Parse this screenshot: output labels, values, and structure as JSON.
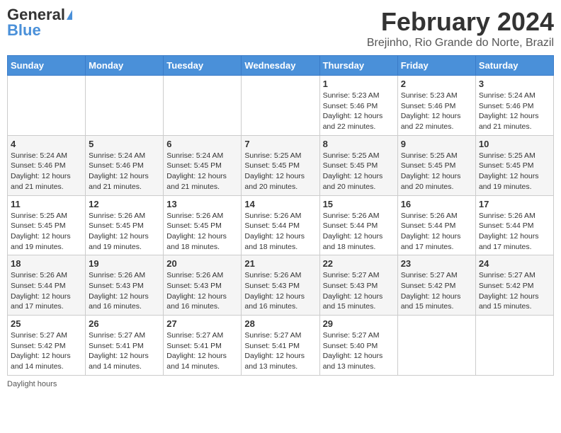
{
  "logo": {
    "general": "General",
    "blue": "Blue"
  },
  "title": "February 2024",
  "subtitle": "Brejinho, Rio Grande do Norte, Brazil",
  "days_of_week": [
    "Sunday",
    "Monday",
    "Tuesday",
    "Wednesday",
    "Thursday",
    "Friday",
    "Saturday"
  ],
  "weeks": [
    [
      {
        "day": "",
        "info": ""
      },
      {
        "day": "",
        "info": ""
      },
      {
        "day": "",
        "info": ""
      },
      {
        "day": "",
        "info": ""
      },
      {
        "day": "1",
        "info": "Sunrise: 5:23 AM\nSunset: 5:46 PM\nDaylight: 12 hours and 22 minutes."
      },
      {
        "day": "2",
        "info": "Sunrise: 5:23 AM\nSunset: 5:46 PM\nDaylight: 12 hours and 22 minutes."
      },
      {
        "day": "3",
        "info": "Sunrise: 5:24 AM\nSunset: 5:46 PM\nDaylight: 12 hours and 21 minutes."
      }
    ],
    [
      {
        "day": "4",
        "info": "Sunrise: 5:24 AM\nSunset: 5:46 PM\nDaylight: 12 hours and 21 minutes."
      },
      {
        "day": "5",
        "info": "Sunrise: 5:24 AM\nSunset: 5:46 PM\nDaylight: 12 hours and 21 minutes."
      },
      {
        "day": "6",
        "info": "Sunrise: 5:24 AM\nSunset: 5:45 PM\nDaylight: 12 hours and 21 minutes."
      },
      {
        "day": "7",
        "info": "Sunrise: 5:25 AM\nSunset: 5:45 PM\nDaylight: 12 hours and 20 minutes."
      },
      {
        "day": "8",
        "info": "Sunrise: 5:25 AM\nSunset: 5:45 PM\nDaylight: 12 hours and 20 minutes."
      },
      {
        "day": "9",
        "info": "Sunrise: 5:25 AM\nSunset: 5:45 PM\nDaylight: 12 hours and 20 minutes."
      },
      {
        "day": "10",
        "info": "Sunrise: 5:25 AM\nSunset: 5:45 PM\nDaylight: 12 hours and 19 minutes."
      }
    ],
    [
      {
        "day": "11",
        "info": "Sunrise: 5:25 AM\nSunset: 5:45 PM\nDaylight: 12 hours and 19 minutes."
      },
      {
        "day": "12",
        "info": "Sunrise: 5:26 AM\nSunset: 5:45 PM\nDaylight: 12 hours and 19 minutes."
      },
      {
        "day": "13",
        "info": "Sunrise: 5:26 AM\nSunset: 5:45 PM\nDaylight: 12 hours and 18 minutes."
      },
      {
        "day": "14",
        "info": "Sunrise: 5:26 AM\nSunset: 5:44 PM\nDaylight: 12 hours and 18 minutes."
      },
      {
        "day": "15",
        "info": "Sunrise: 5:26 AM\nSunset: 5:44 PM\nDaylight: 12 hours and 18 minutes."
      },
      {
        "day": "16",
        "info": "Sunrise: 5:26 AM\nSunset: 5:44 PM\nDaylight: 12 hours and 17 minutes."
      },
      {
        "day": "17",
        "info": "Sunrise: 5:26 AM\nSunset: 5:44 PM\nDaylight: 12 hours and 17 minutes."
      }
    ],
    [
      {
        "day": "18",
        "info": "Sunrise: 5:26 AM\nSunset: 5:44 PM\nDaylight: 12 hours and 17 minutes."
      },
      {
        "day": "19",
        "info": "Sunrise: 5:26 AM\nSunset: 5:43 PM\nDaylight: 12 hours and 16 minutes."
      },
      {
        "day": "20",
        "info": "Sunrise: 5:26 AM\nSunset: 5:43 PM\nDaylight: 12 hours and 16 minutes."
      },
      {
        "day": "21",
        "info": "Sunrise: 5:26 AM\nSunset: 5:43 PM\nDaylight: 12 hours and 16 minutes."
      },
      {
        "day": "22",
        "info": "Sunrise: 5:27 AM\nSunset: 5:43 PM\nDaylight: 12 hours and 15 minutes."
      },
      {
        "day": "23",
        "info": "Sunrise: 5:27 AM\nSunset: 5:42 PM\nDaylight: 12 hours and 15 minutes."
      },
      {
        "day": "24",
        "info": "Sunrise: 5:27 AM\nSunset: 5:42 PM\nDaylight: 12 hours and 15 minutes."
      }
    ],
    [
      {
        "day": "25",
        "info": "Sunrise: 5:27 AM\nSunset: 5:42 PM\nDaylight: 12 hours and 14 minutes."
      },
      {
        "day": "26",
        "info": "Sunrise: 5:27 AM\nSunset: 5:41 PM\nDaylight: 12 hours and 14 minutes."
      },
      {
        "day": "27",
        "info": "Sunrise: 5:27 AM\nSunset: 5:41 PM\nDaylight: 12 hours and 14 minutes."
      },
      {
        "day": "28",
        "info": "Sunrise: 5:27 AM\nSunset: 5:41 PM\nDaylight: 12 hours and 13 minutes."
      },
      {
        "day": "29",
        "info": "Sunrise: 5:27 AM\nSunset: 5:40 PM\nDaylight: 12 hours and 13 minutes."
      },
      {
        "day": "",
        "info": ""
      },
      {
        "day": "",
        "info": ""
      }
    ]
  ],
  "footer": {
    "daylight_label": "Daylight hours"
  }
}
